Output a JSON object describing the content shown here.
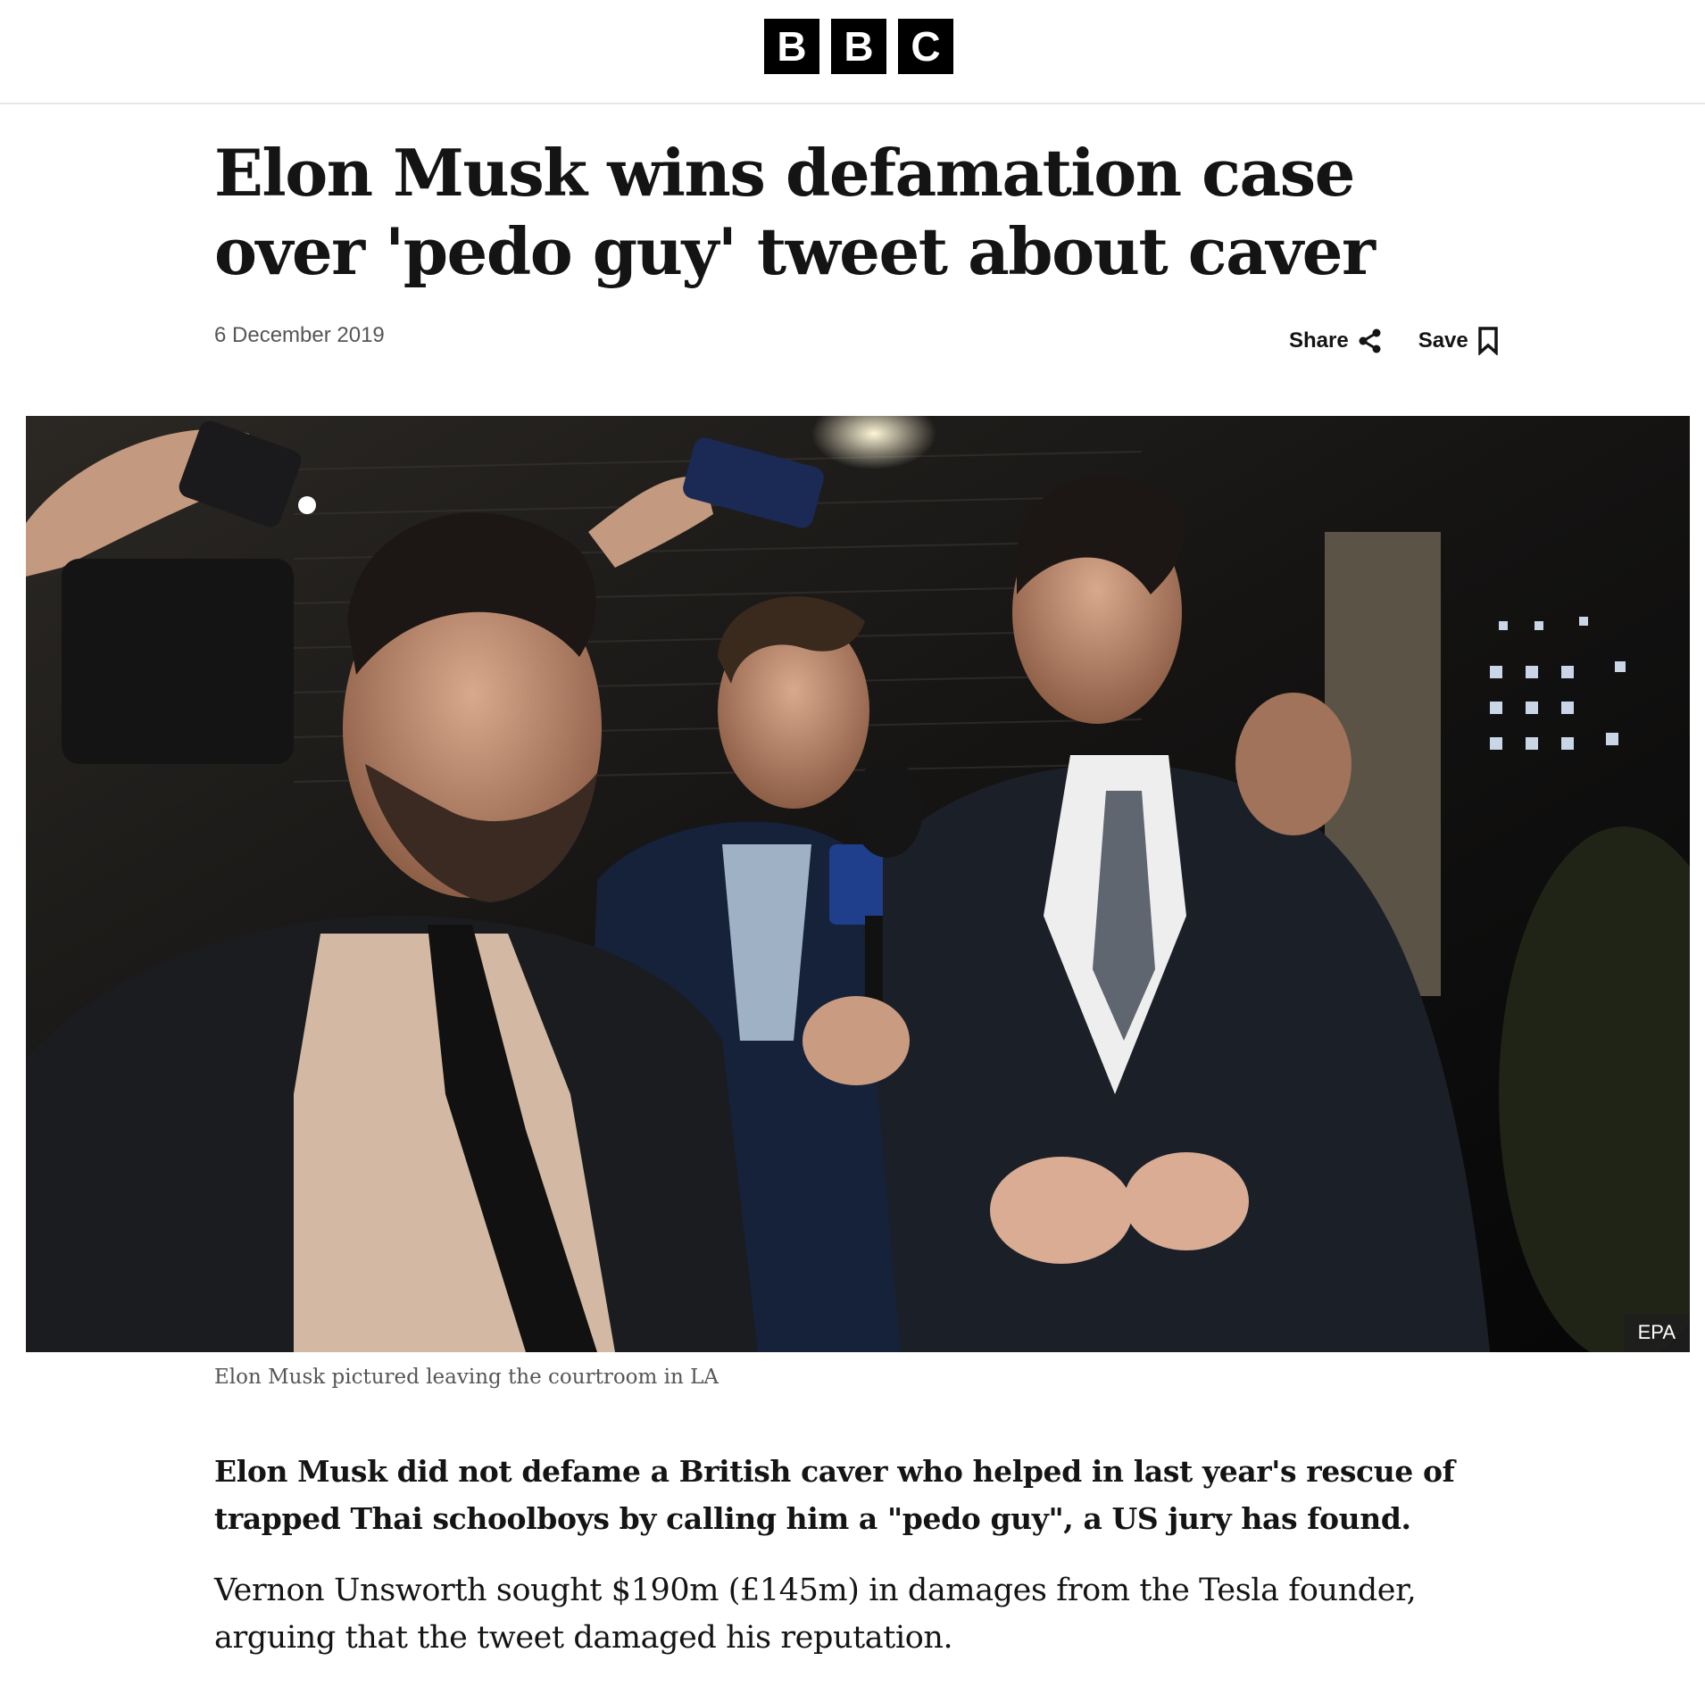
{
  "header": {
    "logo_letters": [
      "B",
      "B",
      "C"
    ]
  },
  "article": {
    "headline": "Elon Musk wins defamation case over 'pedo guy' tweet about caver",
    "date": "6 December 2019",
    "share_label": "Share",
    "save_label": "Save",
    "image": {
      "credit": "EPA",
      "caption": "Elon Musk pictured leaving the courtroom in LA"
    },
    "lede": "Elon Musk did not defame a British caver who helped in last year's rescue of trapped Thai schoolboys by calling him a \"pedo guy\", a US jury has found.",
    "paragraphs": [
      "Vernon Unsworth sought $190m (£145m) in damages from the Tesla founder, arguing that the tweet damaged his reputation."
    ]
  },
  "icons": {
    "share": "share-icon",
    "save": "bookmark-icon"
  }
}
